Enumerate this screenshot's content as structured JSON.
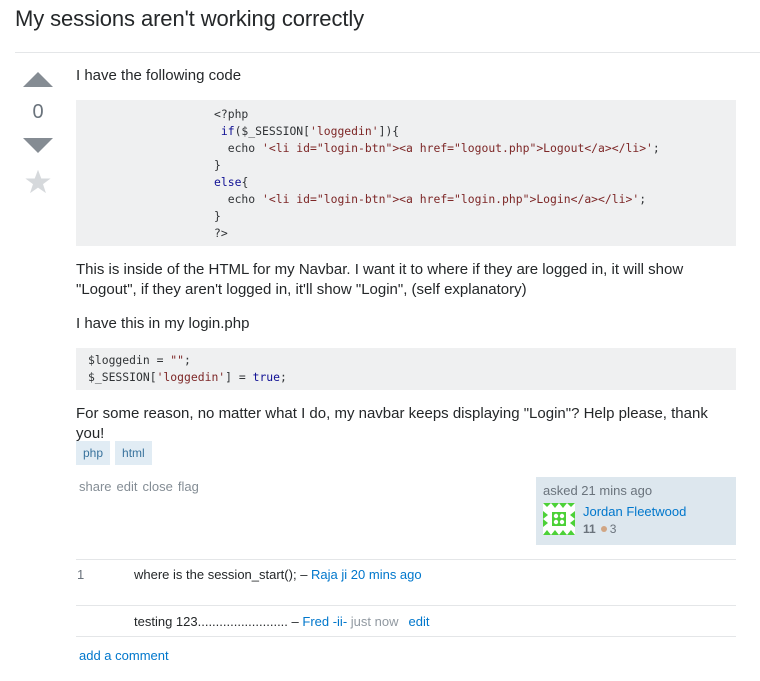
{
  "question": {
    "title": "My sessions aren't working correctly",
    "votes": "0",
    "icons": {
      "upvote": "upvote-arrow-icon",
      "downvote": "downvote-arrow-icon",
      "favorite": "star-icon"
    },
    "body": {
      "para1": "I have the following code",
      "code1_lines": [
        [
          {
            "t": "<?php",
            "c": ""
          }
        ],
        [
          {
            "t": " ",
            "c": ""
          },
          {
            "t": "if",
            "c": "kw"
          },
          {
            "t": "($_SESSION[",
            "c": ""
          },
          {
            "t": "'loggedin'",
            "c": "str"
          },
          {
            "t": "]){",
            "c": ""
          }
        ],
        [
          {
            "t": "  echo ",
            "c": ""
          },
          {
            "t": "'<li id=\"login-btn\"><a href=\"logout.php\">Logout</a></li>'",
            "c": "str"
          },
          {
            "t": ";",
            "c": ""
          }
        ],
        [
          {
            "t": "}",
            "c": ""
          }
        ],
        [
          {
            "t": "else",
            "c": "kw"
          },
          {
            "t": "{",
            "c": ""
          }
        ],
        [
          {
            "t": "  echo ",
            "c": ""
          },
          {
            "t": "'<li id=\"login-btn\"><a href=\"login.php\">Login</a></li>'",
            "c": "str"
          },
          {
            "t": ";",
            "c": ""
          }
        ],
        [
          {
            "t": "}",
            "c": ""
          }
        ],
        [
          {
            "t": "?>",
            "c": ""
          }
        ]
      ],
      "para2": "This is inside of the HTML for my Navbar. I want it to where if they are logged in, it will show \"Logout\", if they aren't logged in, it'll show \"Login\", (self explanatory)",
      "para3": "I have this in my login.php",
      "code2_lines": [
        [
          {
            "t": "$loggedin = ",
            "c": ""
          },
          {
            "t": "\"\"",
            "c": "str"
          },
          {
            "t": ";",
            "c": ""
          }
        ],
        [
          {
            "t": "$_SESSION[",
            "c": ""
          },
          {
            "t": "'loggedin'",
            "c": "str"
          },
          {
            "t": "] = ",
            "c": ""
          },
          {
            "t": "true",
            "c": "kw"
          },
          {
            "t": ";",
            "c": ""
          }
        ]
      ],
      "para4": "For some reason, no matter what I do, my navbar keeps displaying \"Login\"? Help please, thank you!"
    },
    "tags": [
      "php",
      "html"
    ],
    "menu": [
      "share",
      "edit",
      "close",
      "flag"
    ],
    "owner": {
      "asked": "asked 21 mins ago",
      "name": "Jordan Fleetwood",
      "reputation": "11",
      "bronze_badges": "3",
      "avatar_color": "#4cd137"
    }
  },
  "comments": [
    {
      "score": "1",
      "text": "where is the session_start();",
      "sep": " – ",
      "user": "Raja ji",
      "date": "20 mins ago",
      "date_style": "link",
      "edit": ""
    },
    {
      "score": "",
      "text": "testing 123.........................",
      "sep": " – ",
      "user": "Fred -ii-",
      "date": "just now",
      "date_style": "grey",
      "edit": "edit"
    }
  ],
  "add_comment": "add a comment",
  "colors": {
    "link": "#0077cc",
    "tag_bg": "#e1ecf4",
    "tag_text": "#39739d",
    "code_bg": "#eff0f1",
    "card_bg": "#dde7ee"
  }
}
